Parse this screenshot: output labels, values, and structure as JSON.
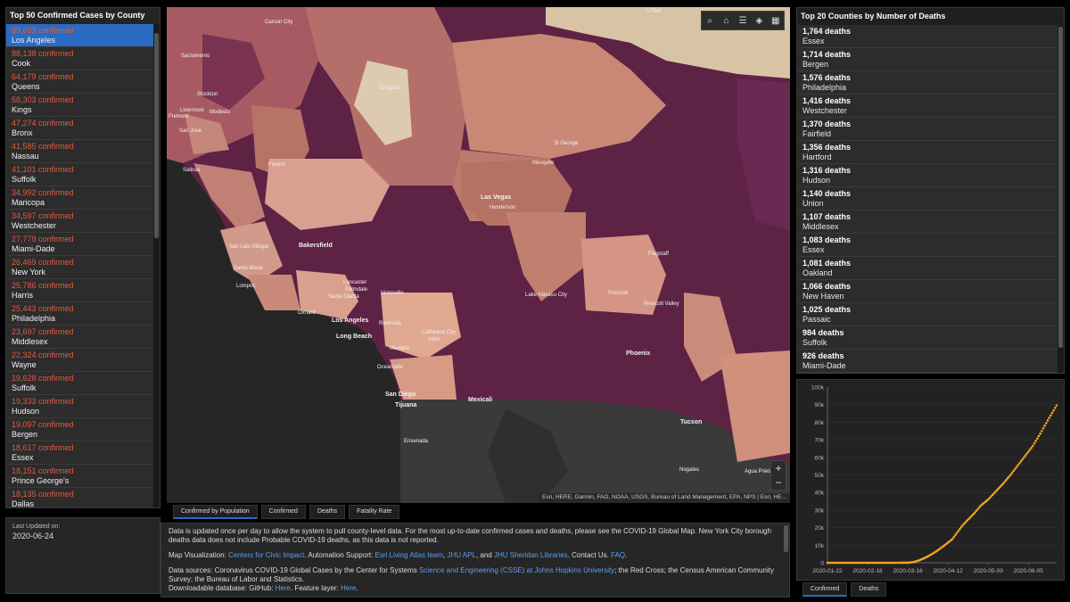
{
  "left_panel": {
    "title": "Top 50 Confirmed Cases by County",
    "items": [
      {
        "count": "89,633 confirmed",
        "county": "Los Angeles"
      },
      {
        "count": "88,138 confirmed",
        "county": "Cook"
      },
      {
        "count": "64,179 confirmed",
        "county": "Queens"
      },
      {
        "count": "58,303 confirmed",
        "county": "Kings"
      },
      {
        "count": "47,274 confirmed",
        "county": "Bronx"
      },
      {
        "count": "41,585 confirmed",
        "county": "Nassau"
      },
      {
        "count": "41,101 confirmed",
        "county": "Suffolk"
      },
      {
        "count": "34,992 confirmed",
        "county": "Maricopa"
      },
      {
        "count": "34,597 confirmed",
        "county": "Westchester"
      },
      {
        "count": "27,779 confirmed",
        "county": "Miami-Dade"
      },
      {
        "count": "26,469 confirmed",
        "county": "New York"
      },
      {
        "count": "25,786 confirmed",
        "county": "Harris"
      },
      {
        "count": "25,443 confirmed",
        "county": "Philadelphia"
      },
      {
        "count": "23,697 confirmed",
        "county": "Middlesex"
      },
      {
        "count": "22,324 confirmed",
        "county": "Wayne"
      },
      {
        "count": "19,628 confirmed",
        "county": "Suffolk"
      },
      {
        "count": "19,333 confirmed",
        "county": "Hudson"
      },
      {
        "count": "19,097 confirmed",
        "county": "Bergen"
      },
      {
        "count": "18,617 confirmed",
        "county": "Essex"
      },
      {
        "count": "18,151 confirmed",
        "county": "Prince George's"
      },
      {
        "count": "18,135 confirmed",
        "county": "Dallas"
      }
    ]
  },
  "last_updated": {
    "label": "Last Updated on:",
    "value": "2020-06-24"
  },
  "map": {
    "labels": {
      "carson_city": "Carson City",
      "utah": "UTAH",
      "sacramento": "Sacramento",
      "stockton": "Stockton",
      "livermore": "Livermore",
      "modesto": "Modesto",
      "fremont": "Fremont",
      "san_jose": "San Jose",
      "tonopah": "Tonopah",
      "st_george": "St George",
      "fresno": "Fresno",
      "salinas": "Salinas",
      "mesquite": "Mesquite",
      "las_vegas": "Las Vegas",
      "henderson": "Henderson",
      "bakersfield": "Bakersfield",
      "san_luis_obispo": "San Luis Obispo",
      "santa_maria": "Santa Maria",
      "lompoc": "Lompoc",
      "lancaster": "Lancaster",
      "palmdale": "Palmdale",
      "santa_clarita": "Santa Clarita",
      "victorville": "Victorville",
      "oxnard": "Oxnard",
      "los_angeles": "Los Angeles",
      "long_beach": "Long Beach",
      "riverside": "Riverside",
      "murrieta": "Murrieta",
      "cathedral_city": "Cathedral City",
      "indio": "Indio",
      "oceanside": "Oceanside",
      "flagstaff": "Flagstaff",
      "prescott": "Prescott",
      "prescott_valley": "Prescott Valley",
      "lake_havasu_city": "Lake Havasu City",
      "phoenix": "Phoenix",
      "san_diego": "San Diego",
      "tijuana": "Tijuana",
      "mexicali": "Mexicali",
      "ensenada": "Ensenada",
      "tucson": "Tucson",
      "nogales": "Nogales",
      "agua_prieta": "Agua Prieta"
    },
    "attribution": "Esri, HERE, Garmin, FAO, NOAA, USGS, Bureau of Land Management, EPA, NPS | Esri, HE...",
    "zoom_in": "+",
    "zoom_out": "−",
    "toolbar_icons": [
      "search-icon",
      "home-icon",
      "list-icon",
      "layers-icon",
      "qr-icon"
    ]
  },
  "map_tabs": [
    "Confirmed by Population",
    "Confirmed",
    "Deaths",
    "Fatality Rate"
  ],
  "info": {
    "p1": "Data is updated once per day to allow the system to pull county-level data. For the most up-to-date confirmed cases and deaths, please see the COVID-19 Global Map. New York City borough deaths data does not include Probable COVID-19 deaths, as this data is not reported.",
    "map_vis_label": "Map Visualization: ",
    "map_vis_link": "Centers for Civic Impact",
    "auto_label": ". Automation Support: ",
    "auto_link1": "Esri Living Atlas team",
    "auto_sep1": ", ",
    "auto_link2": "JHU APL",
    "auto_sep2": ", and ",
    "auto_link3": "JHU Sheridan Libraries",
    "contact": ". Contact Us. ",
    "faq_link": "FAQ",
    "faq_end": ".",
    "sources_label": "Data sources: Coronavirus COVID-19 Global Cases by the Center for Systems ",
    "sources_link": "Science and Engineering (CSSE) at Johns Hopkins University",
    "sources_rest": "; the Red Cross; the Census American Community Survey; the Bureau of Labor and Statistics.",
    "download_label": "Downloadable database: GitHub: ",
    "download_link1": "Here",
    "download_mid": ". Feature layer: ",
    "download_link2": "Here",
    "download_end": "."
  },
  "right_panel": {
    "title": "Top 20 Counties by Number of Deaths",
    "items": [
      {
        "count": "1,764 deaths",
        "county": "Essex"
      },
      {
        "count": "1,714 deaths",
        "county": "Bergen"
      },
      {
        "count": "1,576 deaths",
        "county": "Philadelphia"
      },
      {
        "count": "1,416 deaths",
        "county": "Westchester"
      },
      {
        "count": "1,370 deaths",
        "county": "Fairfield"
      },
      {
        "count": "1,356 deaths",
        "county": "Hartford"
      },
      {
        "count": "1,316 deaths",
        "county": "Hudson"
      },
      {
        "count": "1,140 deaths",
        "county": "Union"
      },
      {
        "count": "1,107 deaths",
        "county": "Middlesex"
      },
      {
        "count": "1,083 deaths",
        "county": "Essex"
      },
      {
        "count": "1,081 deaths",
        "county": "Oakland"
      },
      {
        "count": "1,066 deaths",
        "county": "New Haven"
      },
      {
        "count": "1,025 deaths",
        "county": "Passaic"
      },
      {
        "count": "984 deaths",
        "county": "Suffolk"
      },
      {
        "count": "926 deaths",
        "county": "Miami-Dade"
      }
    ]
  },
  "chart_data": {
    "type": "scatter",
    "y_ticks": [
      "0",
      "10k",
      "20k",
      "30k",
      "40k",
      "50k",
      "60k",
      "70k",
      "80k",
      "90k",
      "100k"
    ],
    "x_ticks": [
      "2020-01-22",
      "2020-02-18",
      "2020-03-16",
      "2020-04-12",
      "2020-05-09",
      "2020-06-05"
    ],
    "ylim": [
      0,
      100000
    ],
    "xlim": [
      "2020-01-22",
      "2020-06-24"
    ],
    "point_color": "#f5a623",
    "points": [
      [
        "2020-01-22",
        0
      ],
      [
        "2020-02-18",
        0
      ],
      [
        "2020-03-01",
        0
      ],
      [
        "2020-03-10",
        0
      ],
      [
        "2020-03-16",
        50
      ],
      [
        "2020-03-20",
        400
      ],
      [
        "2020-03-24",
        1500
      ],
      [
        "2020-03-28",
        3000
      ],
      [
        "2020-04-01",
        4800
      ],
      [
        "2020-04-05",
        7000
      ],
      [
        "2020-04-09",
        9500
      ],
      [
        "2020-04-12",
        11500
      ],
      [
        "2020-04-15",
        13500
      ],
      [
        "2020-04-18",
        17000
      ],
      [
        "2020-04-22",
        21500
      ],
      [
        "2020-04-26",
        25000
      ],
      [
        "2020-04-30",
        28500
      ],
      [
        "2020-05-04",
        32500
      ],
      [
        "2020-05-09",
        36000
      ],
      [
        "2020-05-14",
        40500
      ],
      [
        "2020-05-19",
        45000
      ],
      [
        "2020-05-24",
        50000
      ],
      [
        "2020-05-29",
        55500
      ],
      [
        "2020-06-03",
        61000
      ],
      [
        "2020-06-08",
        66500
      ],
      [
        "2020-06-13",
        73500
      ],
      [
        "2020-06-18",
        81000
      ],
      [
        "2020-06-24",
        89600
      ]
    ]
  },
  "chart_tabs": [
    "Confirmed",
    "Deaths"
  ]
}
